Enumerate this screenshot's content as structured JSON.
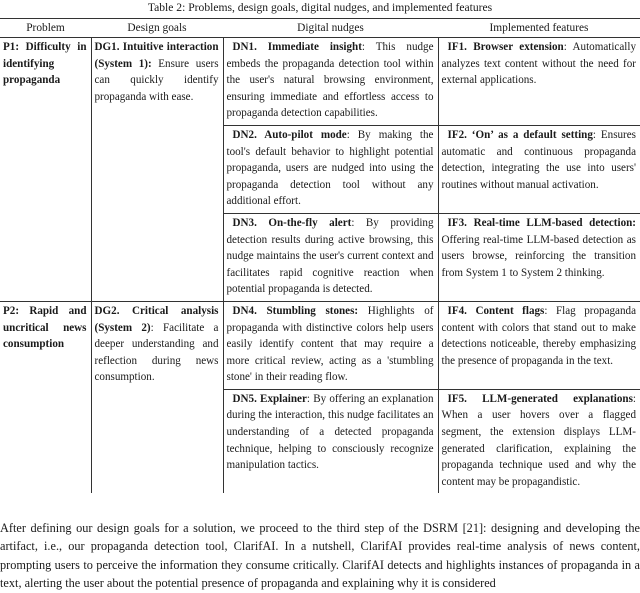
{
  "caption": "Table 2: Problems, design goals, digital nudges, and implemented features",
  "table": {
    "headers": [
      "Problem",
      "Design goals",
      "Digital nudges",
      "Implemented features"
    ],
    "groups": [
      {
        "problem": "P1: Difficulty in identifying propaganda",
        "goal": {
          "title": "DG1. Intuitive interaction (System 1):",
          "text": " Ensure users can quickly identify propaganda with ease."
        },
        "rows": [
          {
            "nudge": {
              "title": "DN1. Immediate insight",
              "text": ": This nudge embeds the propaganda detection tool within the user's natural browsing environment, ensuring immediate and effortless access to propaganda detection capabilities."
            },
            "feature": {
              "title": "IF1. Browser extension",
              "text": ": Automatically analyzes text content without the need for external applications."
            }
          },
          {
            "nudge": {
              "title": "DN2. Auto-pilot mode",
              "text": ": By making the tool's default behavior to highlight potential propaganda, users are nudged into using the propaganda detection tool without any additional effort."
            },
            "feature": {
              "title": "IF2. ‘On’ as a default setting",
              "text": ": Ensures automatic and continuous propaganda detection, integrating the use into users' routines without manual activation."
            }
          },
          {
            "nudge": {
              "title": "DN3. On-the-fly alert",
              "text": ": By providing detection results during active browsing, this nudge maintains the user's current context and facilitates rapid cognitive reaction when potential propaganda is detected."
            },
            "feature": {
              "title": "IF3. Real-time LLM-based detection:",
              "text": " Offering real-time LLM-based detection as users browse, reinforcing the transition from System 1 to System 2 thinking."
            }
          }
        ]
      },
      {
        "problem": "P2: Rapid and uncritical news consumption",
        "goal": {
          "title": "DG2. Critical analysis (System 2)",
          "text": ": Facilitate a deeper understanding and reflection during news consumption."
        },
        "rows": [
          {
            "nudge": {
              "title": "DN4. Stumbling stones:",
              "text": " Highlights of propaganda with distinctive colors help users easily identify content that may require a more critical review, acting as a 'stumbling stone' in their reading flow."
            },
            "feature": {
              "title": "IF4. Content flags",
              "text": ": Flag propaganda content with colors that stand out to make detections noticeable, thereby emphasizing the presence of propaganda in the text."
            }
          },
          {
            "nudge": {
              "title": "DN5. Explainer",
              "text": ": By offering an explanation during the interaction, this nudge facilitates an understanding of a detected propaganda technique, helping to consciously recognize manipulation tactics."
            },
            "feature": {
              "title": "IF5. LLM-generated explanations",
              "text": ": When a user hovers over a flagged segment, the extension displays LLM-generated clarification, explaining the propaganda technique used and why the content may be propagandistic."
            }
          }
        ]
      }
    ]
  },
  "body_text": "After defining our design goals for a solution, we proceed to the third step of the DSRM [21]: designing and developing the artifact, i.e., our propaganda detection tool, ClarifAI. In a nutshell, ClarifAI provides real-time analysis of news content, prompting users to perceive the information they consume critically. ClarifAI detects and highlights instances of propaganda in a text, alerting the user about the potential presence of propaganda and explaining why it is considered"
}
